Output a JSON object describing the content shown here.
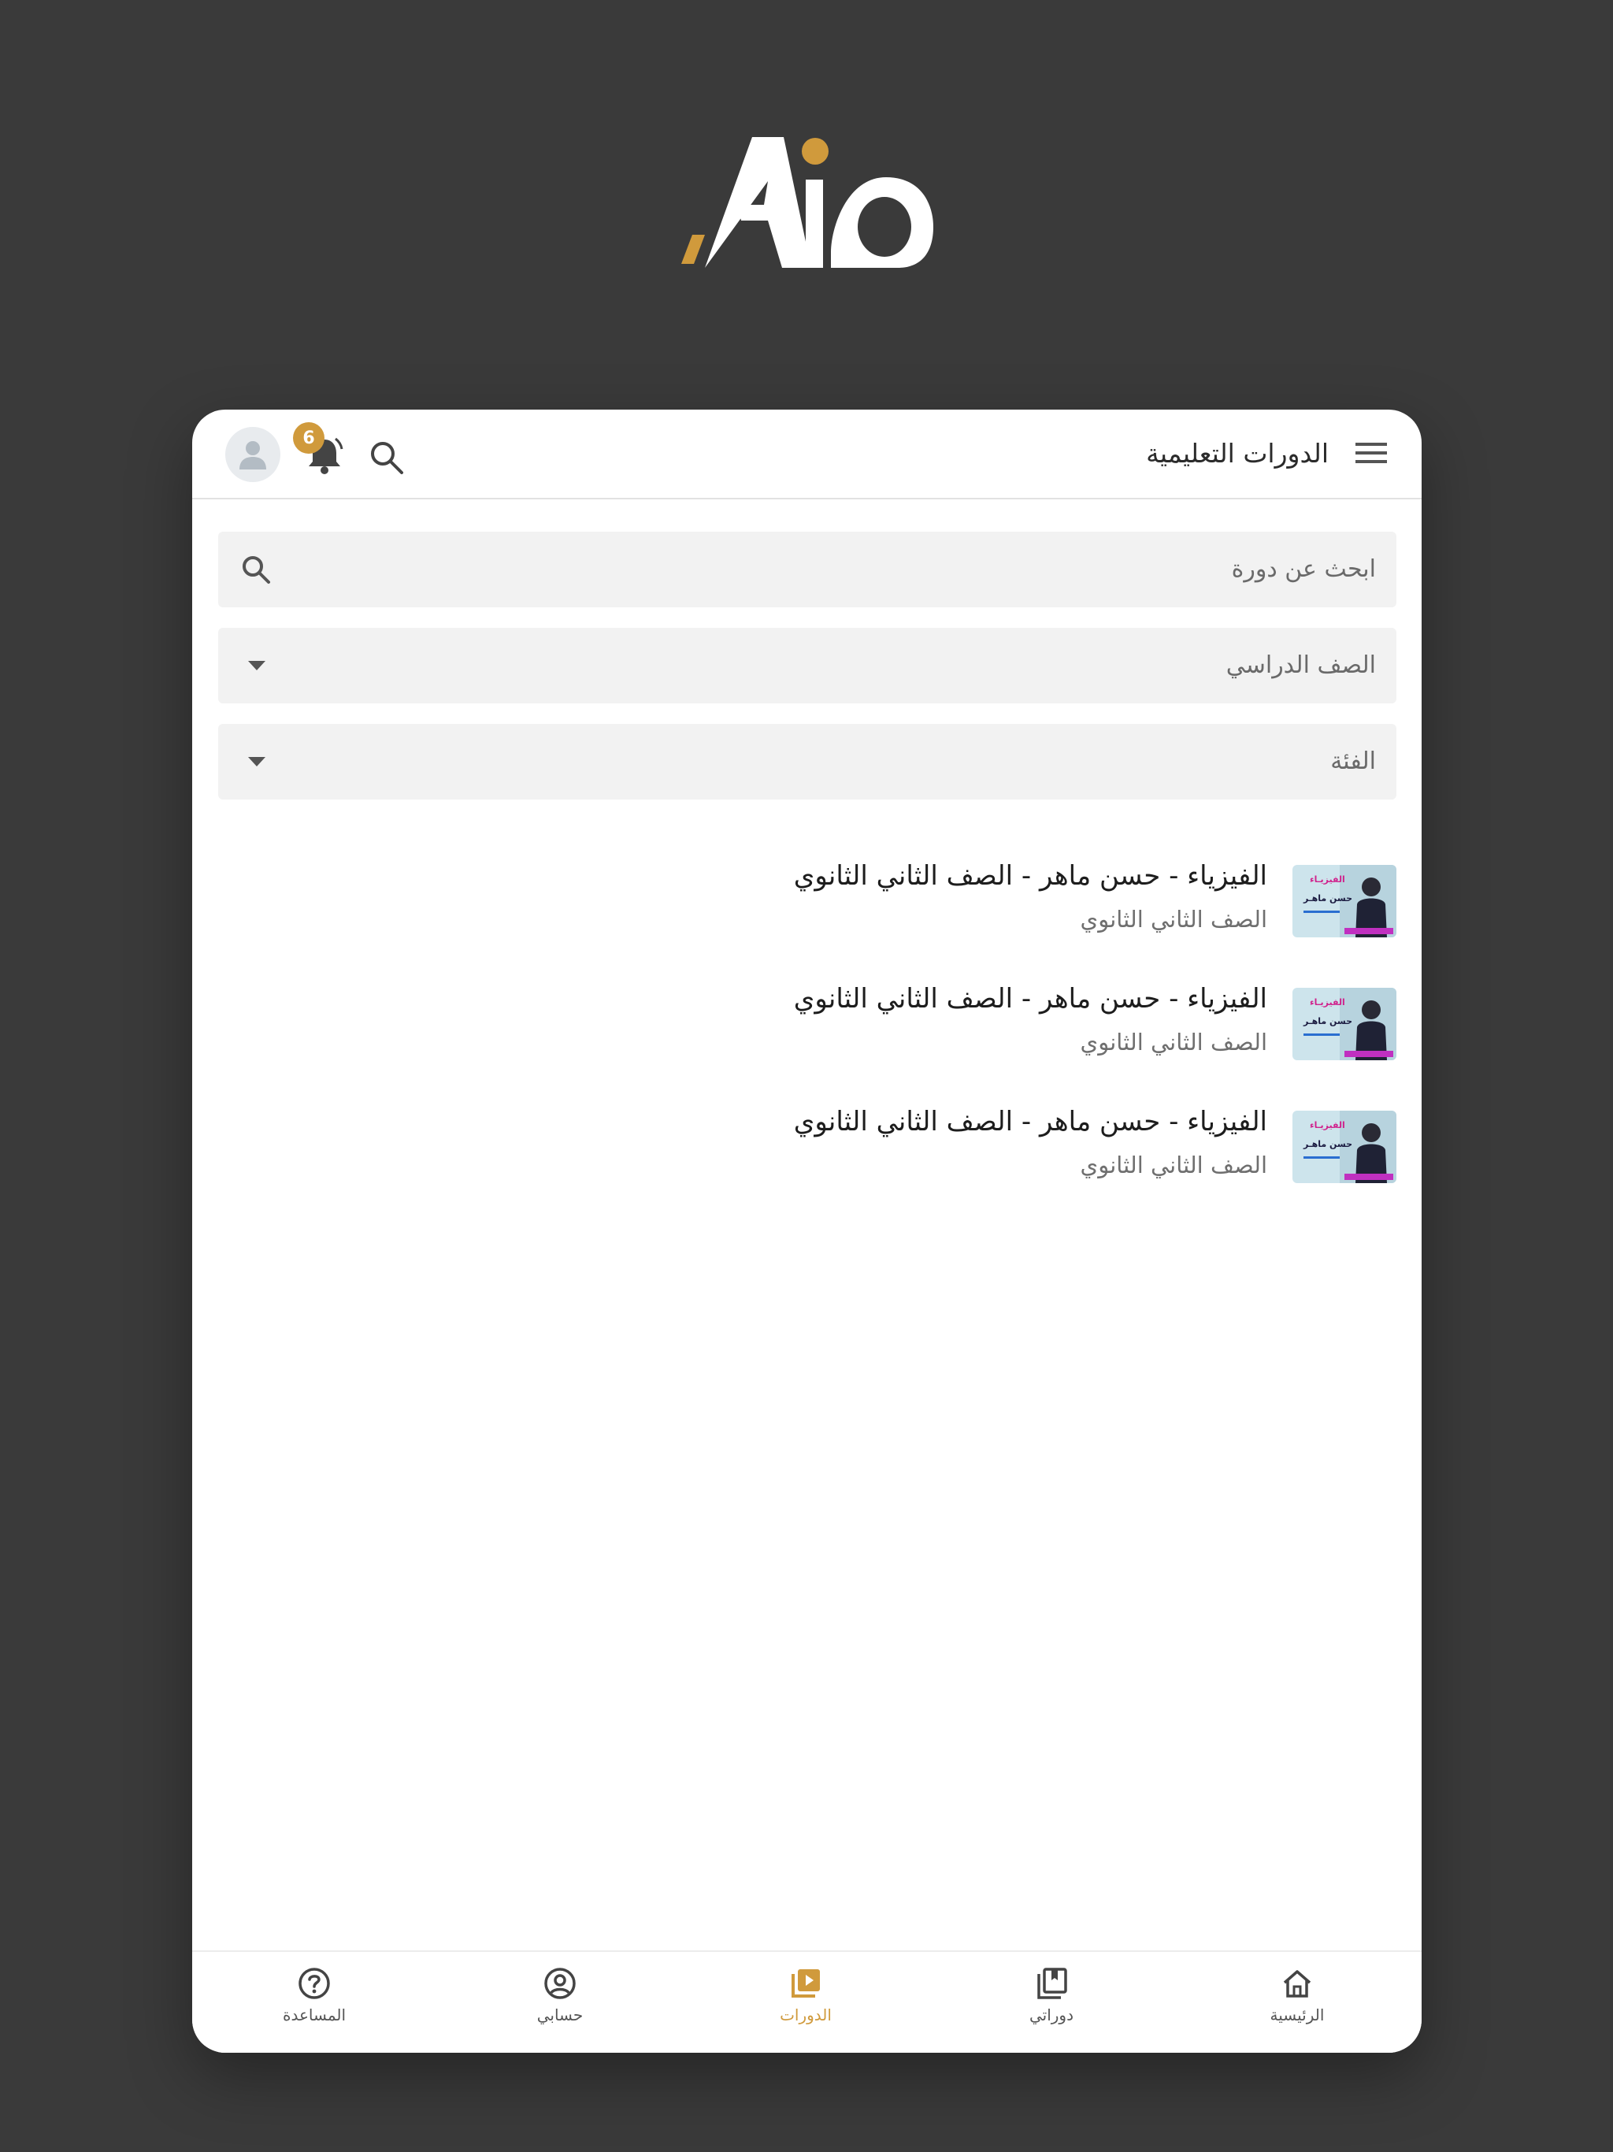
{
  "brand": {
    "logo_text": "Aio",
    "accent": "#d09a3c"
  },
  "header": {
    "title": "الدورات التعليمية",
    "notifications_count": "6"
  },
  "search": {
    "placeholder": "ابحث عن دورة"
  },
  "filters": {
    "grade_label": "الصف الدراسي",
    "category_label": "الفئة"
  },
  "courses": [
    {
      "title": "الفيزياء - حسن ماهر - الصف الثاني الثانوي",
      "grade": "الصف الثاني الثانوي",
      "thumb_heading": "الفيزيـاء",
      "thumb_name": "حسن ماهـر"
    },
    {
      "title": "الفيزياء - حسن ماهر - الصف الثاني الثانوي",
      "grade": "الصف الثاني الثانوي",
      "thumb_heading": "الفيزيـاء",
      "thumb_name": "حسن ماهـر"
    },
    {
      "title": "الفيزياء - حسن ماهر - الصف الثاني الثانوي",
      "grade": "الصف الثاني الثانوي",
      "thumb_heading": "الفيزيـاء",
      "thumb_name": "حسن ماهـر"
    }
  ],
  "bottom_nav": [
    {
      "label": "المساعدة",
      "icon": "help-icon"
    },
    {
      "label": "حسابي",
      "icon": "account-icon"
    },
    {
      "label": "الدورات",
      "icon": "courses-icon",
      "active": true
    },
    {
      "label": "دوراتي",
      "icon": "my-courses-icon"
    },
    {
      "label": "الرئيسية",
      "icon": "home-icon"
    }
  ]
}
